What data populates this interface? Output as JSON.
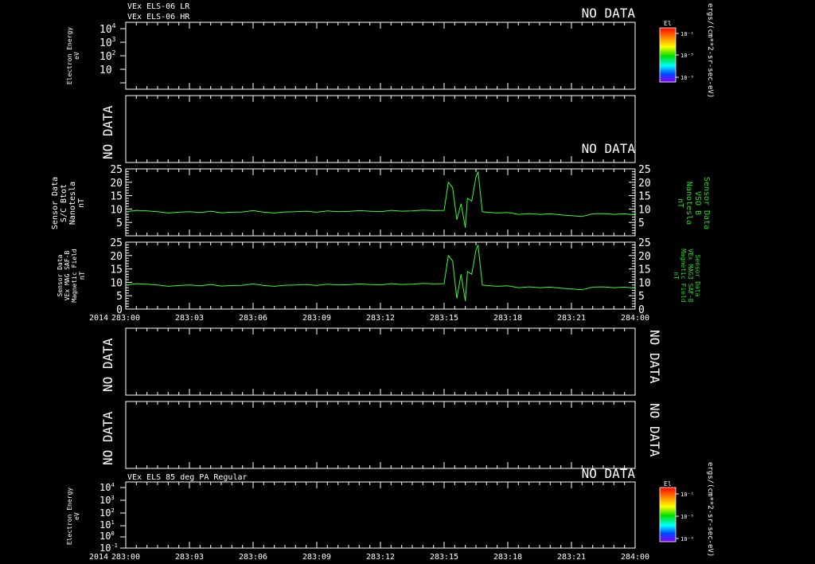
{
  "year_label": "2014",
  "x_ticks": [
    "283:00",
    "283:03",
    "283:06",
    "283:09",
    "283:12",
    "283:15",
    "283:18",
    "283:21",
    "284:00"
  ],
  "colors": {
    "background": "#000000",
    "axis": "#ffffff",
    "trace": "#33ff33",
    "right_label": "#22dd22"
  },
  "no_data_text": "NO DATA",
  "panel1": {
    "titles": [
      "VEx ELS-06 LR",
      "VEx ELS-06 HR"
    ],
    "ylabel": [
      "Electron Energy",
      "eV"
    ],
    "ytick_labels": [
      {
        "base": "10",
        "exp": "4"
      },
      {
        "base": "10",
        "exp": "3"
      },
      {
        "base": "10",
        "exp": "2"
      },
      {
        "base": "10",
        "exp": ""
      }
    ],
    "colorbar": {
      "label": "El",
      "ticks": [
        "10⁻¹",
        "10⁻⁵",
        "10⁻⁹"
      ],
      "units": "ergs/(cm**2-sr-sec-eV)"
    }
  },
  "panel7": {
    "title": "VEx ELS 85 deg PA Regular",
    "ylabel": [
      "Electron Energy",
      "eV"
    ],
    "ytick_labels": [
      {
        "base": "10",
        "exp": "4"
      },
      {
        "base": "10",
        "exp": "3"
      },
      {
        "base": "10",
        "exp": "2"
      },
      {
        "base": "10",
        "exp": "1"
      },
      {
        "base": "10",
        "exp": "0"
      },
      {
        "base": "10",
        "exp": "-1"
      }
    ],
    "colorbar": {
      "label": "El",
      "ticks": [
        "10⁻¹",
        "10⁻⁵",
        "10⁻⁹"
      ],
      "units": "ergs/(cm**2-sr-sec-eV)"
    }
  },
  "panel3": {
    "ylabel_left": [
      "Sensor Data",
      "S/C Btot",
      "Nanotesla",
      "nT"
    ],
    "ylabel_right": [
      "Sensor Data",
      "VSO B",
      "Nanotesla",
      "nT"
    ]
  },
  "panel4": {
    "ylabel_left": [
      "Sensor Data",
      "VEx MAG SAF-B",
      "Magnetic Field",
      "nT"
    ],
    "ylabel_right": [
      "Sensor Data",
      "VEx MAG3 SAF-B",
      "Magnetic Field",
      "nT"
    ]
  },
  "chart_data": {
    "type": "line",
    "x_unit": "day-of-year:hour",
    "xlim": [
      "283:00",
      "284:00"
    ],
    "ylim": [
      0,
      25
    ],
    "yticks": [
      5,
      10,
      15,
      20,
      25
    ],
    "grid": false,
    "series": [
      {
        "x": [
          0,
          0.5,
          1,
          1.5,
          2,
          2.5,
          3,
          3.5,
          4,
          4.5,
          5,
          5.5,
          6,
          6.5,
          7,
          7.5,
          8,
          8.5,
          9,
          9.5,
          10,
          10.5,
          11,
          11.5,
          12,
          12.5,
          13,
          13.5,
          14,
          14.5,
          15,
          15.2,
          15.4,
          15.6,
          15.8,
          16,
          16.1,
          16.3,
          16.5,
          16.6,
          16.8,
          17,
          17.5,
          18,
          18.5,
          19,
          19.5,
          20,
          20.5,
          21,
          21.5,
          22,
          22.5,
          23,
          23.5,
          24
        ],
        "y": [
          9,
          9.5,
          9.3,
          9,
          8.5,
          8.8,
          9,
          8.7,
          9.2,
          8.6,
          8.8,
          8.9,
          9.4,
          8.8,
          8.5,
          8.9,
          9,
          9.2,
          8.8,
          9.3,
          9,
          9.1,
          9.4,
          9.2,
          9,
          9.5,
          9.2,
          9.3,
          9.6,
          9.4,
          9.5,
          20,
          18,
          6,
          12,
          3,
          14,
          13,
          22,
          24,
          9,
          8.8,
          8.5,
          8.7,
          8,
          8.3,
          8,
          8.2,
          7.8,
          7.5,
          7.2,
          8.2,
          8.3,
          8,
          8.2,
          7.8
        ]
      },
      {
        "x": [
          0,
          0.5,
          1,
          1.5,
          2,
          2.5,
          3,
          3.5,
          4,
          4.5,
          5,
          5.5,
          6,
          6.5,
          7,
          7.5,
          8,
          8.5,
          9,
          9.5,
          10,
          10.5,
          11,
          11.5,
          12,
          12.5,
          13,
          13.5,
          14,
          14.5,
          15,
          15.2,
          15.4,
          15.6,
          15.8,
          16,
          16.1,
          16.3,
          16.5,
          16.6,
          16.8,
          17,
          17.5,
          18,
          18.5,
          19,
          19.5,
          20,
          20.5,
          21,
          21.5,
          22,
          22.5,
          23,
          23.5,
          24
        ],
        "y": [
          9,
          9.5,
          9.3,
          9,
          8.5,
          8.8,
          9,
          8.7,
          9.2,
          8.6,
          8.8,
          8.9,
          9.4,
          8.8,
          8.5,
          8.9,
          9,
          9.2,
          8.8,
          9.3,
          9,
          9.1,
          9.4,
          9.2,
          9,
          9.5,
          9.2,
          9.3,
          9.6,
          9.4,
          9.5,
          20,
          18,
          4,
          13,
          3,
          14,
          13,
          22,
          24,
          9,
          8.8,
          8.5,
          8.7,
          8,
          8.3,
          8,
          8.2,
          7.8,
          7.5,
          7.2,
          8.2,
          8.3,
          8,
          8.2,
          7.8
        ]
      }
    ]
  }
}
